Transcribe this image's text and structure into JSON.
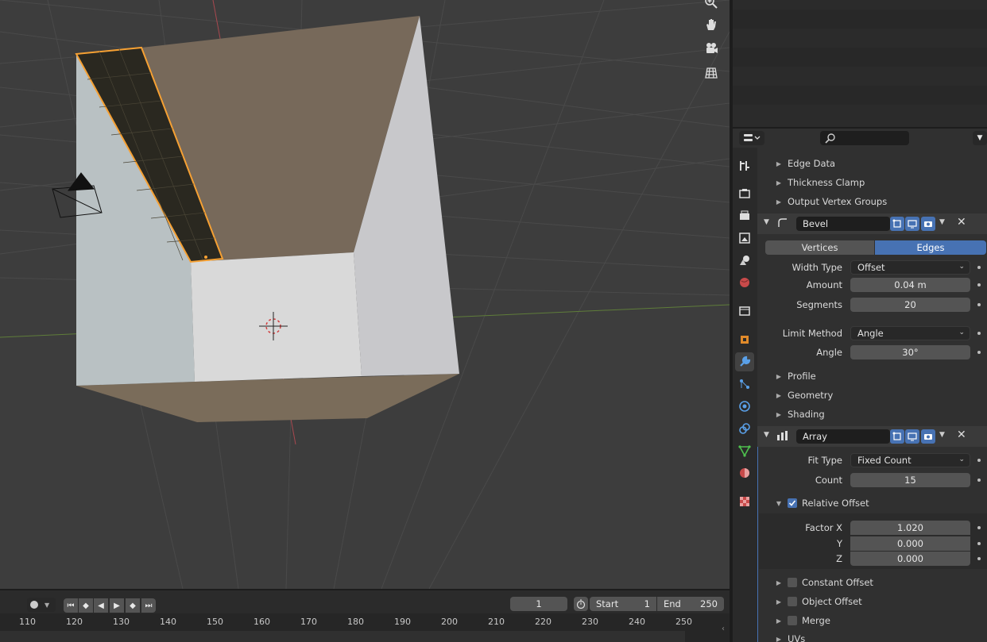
{
  "viewport": {
    "nav_icons": [
      "zoom-icon",
      "hand-pan-icon",
      "camera-view-icon",
      "grid-view-icon"
    ]
  },
  "properties": {
    "search_placeholder": "",
    "top_subpanels": [
      "Edge Data",
      "Thickness Clamp",
      "Output Vertex Groups"
    ],
    "bevel": {
      "name": "Bevel",
      "mode_tabs": [
        "Vertices",
        "Edges"
      ],
      "active_tab": "Edges",
      "width_type_label": "Width Type",
      "width_type_value": "Offset",
      "amount_label": "Amount",
      "amount_value": "0.04 m",
      "segments_label": "Segments",
      "segments_value": "20",
      "limit_method_label": "Limit Method",
      "limit_method_value": "Angle",
      "angle_label": "Angle",
      "angle_value": "30°",
      "subpanels": [
        "Profile",
        "Geometry",
        "Shading"
      ]
    },
    "array": {
      "name": "Array",
      "fit_type_label": "Fit Type",
      "fit_type_value": "Fixed Count",
      "count_label": "Count",
      "count_value": "15",
      "relative_offset_label": "Relative Offset",
      "factor_x_label": "Factor X",
      "factor_x_value": "1.020",
      "y_label": "Y",
      "y_value": "0.000",
      "z_label": "Z",
      "z_value": "0.000",
      "constant_offset_label": "Constant Offset",
      "object_offset_label": "Object Offset",
      "merge_label": "Merge",
      "uvs_label": "UVs"
    }
  },
  "timeline": {
    "current_frame": "1",
    "start_label": "Start",
    "start_value": "1",
    "end_label": "End",
    "end_value": "250",
    "ticks": [
      "110",
      "120",
      "130",
      "140",
      "150",
      "160",
      "170",
      "180",
      "190",
      "200",
      "210",
      "220",
      "230",
      "240",
      "250"
    ]
  },
  "colors": {
    "accent": "#4772b3",
    "selection": "#f5a033",
    "background": "#3d3d3d"
  }
}
